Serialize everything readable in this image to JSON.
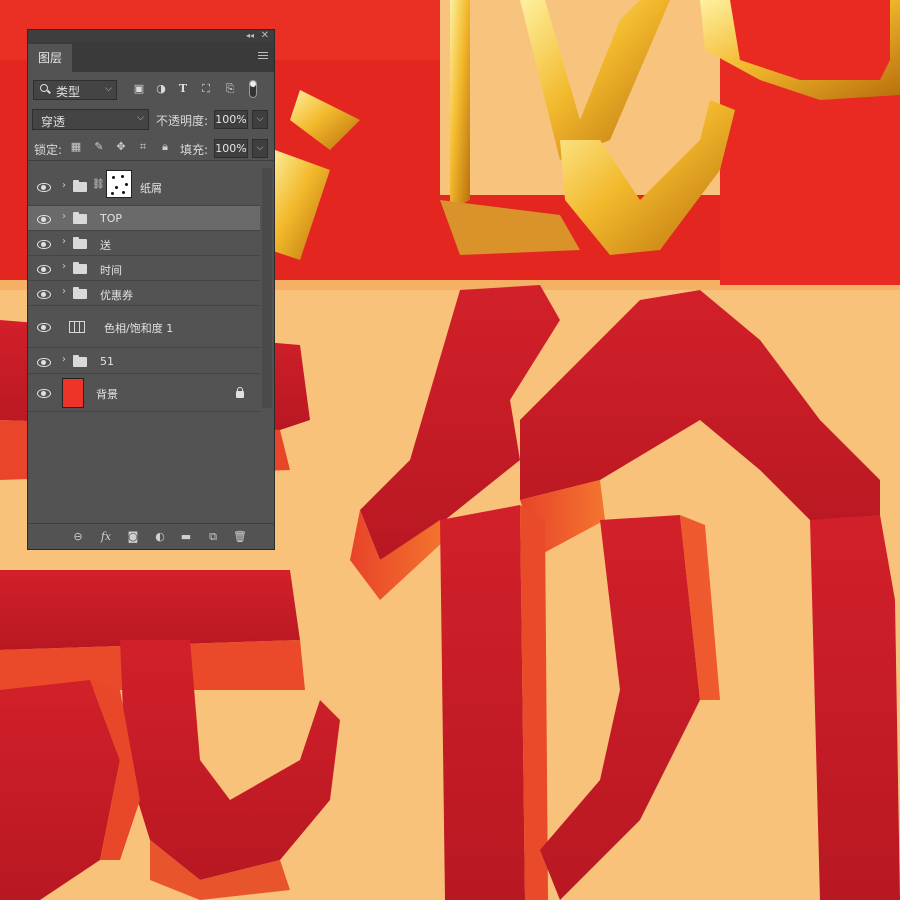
{
  "panel": {
    "tab_label": "图层",
    "filter": {
      "label": "类型"
    },
    "blend_mode": "穿透",
    "opacity_label": "不透明度:",
    "opacity_value": "100%",
    "lock_label": "锁定:",
    "fill_label": "填充:",
    "fill_value": "100%",
    "layers": [
      {
        "name": "纸屑",
        "kind": "group-masked",
        "visible": true
      },
      {
        "name": "TOP",
        "kind": "group",
        "visible": true,
        "selected": true
      },
      {
        "name": "送",
        "kind": "group",
        "visible": true
      },
      {
        "name": "时间",
        "kind": "group",
        "visible": true
      },
      {
        "name": "优惠券",
        "kind": "group",
        "visible": true
      },
      {
        "name": "色相/饱和度 1",
        "kind": "adjustment",
        "visible": true
      },
      {
        "name": "51",
        "kind": "group",
        "visible": true
      },
      {
        "name": "背景",
        "kind": "background",
        "visible": true,
        "locked": true
      }
    ]
  },
  "colors": {
    "panel_bg": "#535353",
    "selected_row": "#6a6a6a",
    "art_red": "#e02420",
    "art_cream": "#f9c27a",
    "art_gold": "#e9a72a"
  },
  "icons": {
    "filter_icons": [
      "image-filter-icon",
      "adjustment-filter-icon",
      "type-filter-icon",
      "shape-filter-icon",
      "smart-object-filter-icon",
      "filter-toggle-icon"
    ],
    "lock_icons": [
      "lock-transparent-pixels-icon",
      "lock-image-pixels-icon",
      "lock-position-icon",
      "lock-artboard-icon",
      "lock-all-icon"
    ],
    "bottom_icons": [
      "link-layers-icon",
      "layer-style-icon",
      "add-mask-icon",
      "new-adjustment-icon",
      "new-group-icon",
      "new-layer-icon",
      "delete-layer-icon"
    ]
  }
}
